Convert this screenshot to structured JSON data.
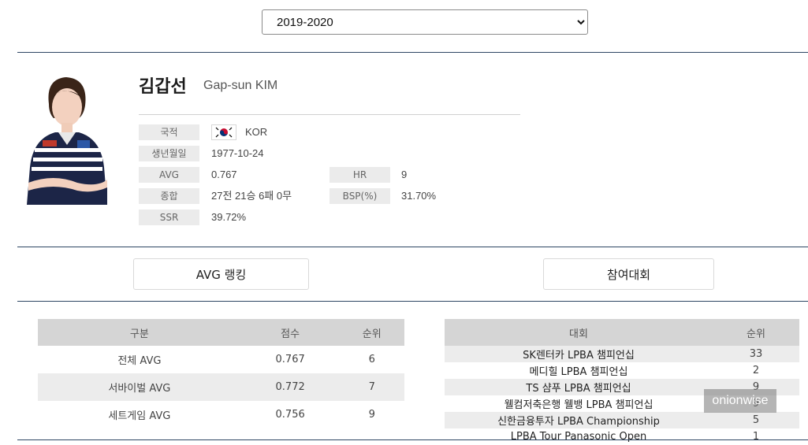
{
  "season": {
    "selected": "2019-2020"
  },
  "player": {
    "name_ko": "김갑선",
    "name_en": "Gap-sun KIM",
    "fields": {
      "nationality_label": "국적",
      "nationality_value": "KOR",
      "birth_label": "생년월일",
      "birth_value": "1977-10-24",
      "avg_label": "AVG",
      "avg_value": "0.767",
      "hr_label": "HR",
      "hr_value": "9",
      "record_label": "종합",
      "record_value": "27전 21승 6패 0무",
      "bsp_label": "BSP(%)",
      "bsp_value": "31.70%",
      "ssr_label": "SSR",
      "ssr_value": "39.72%"
    }
  },
  "tabs": {
    "avg_ranking": "AVG 랭킹",
    "tournaments": "참여대회"
  },
  "avg_table": {
    "headers": [
      "구분",
      "점수",
      "순위"
    ],
    "rows": [
      [
        "전체 AVG",
        "0.767",
        "6"
      ],
      [
        "서바이벌 AVG",
        "0.772",
        "7"
      ],
      [
        "세트게임 AVG",
        "0.756",
        "9"
      ]
    ]
  },
  "tour_table": {
    "headers": [
      "대회",
      "순위"
    ],
    "rows": [
      [
        "SK렌터카 LPBA 챔피언십",
        "33"
      ],
      [
        "메디힐 LPBA 챔피언십",
        "2"
      ],
      [
        "TS 샴푸 LPBA 챔피언십",
        "9"
      ],
      [
        "웰컴저축은행 웰뱅 LPBA 챔피언십",
        "9"
      ],
      [
        "신한금융투자 LPBA Championship",
        "5"
      ],
      [
        "LPBA Tour Panasonic Open",
        "1"
      ]
    ]
  },
  "watermark": "onionwise",
  "colors": {
    "rule": "#2d4663",
    "label_bg": "#ebebeb",
    "header_bg": "#d5d5d5"
  }
}
